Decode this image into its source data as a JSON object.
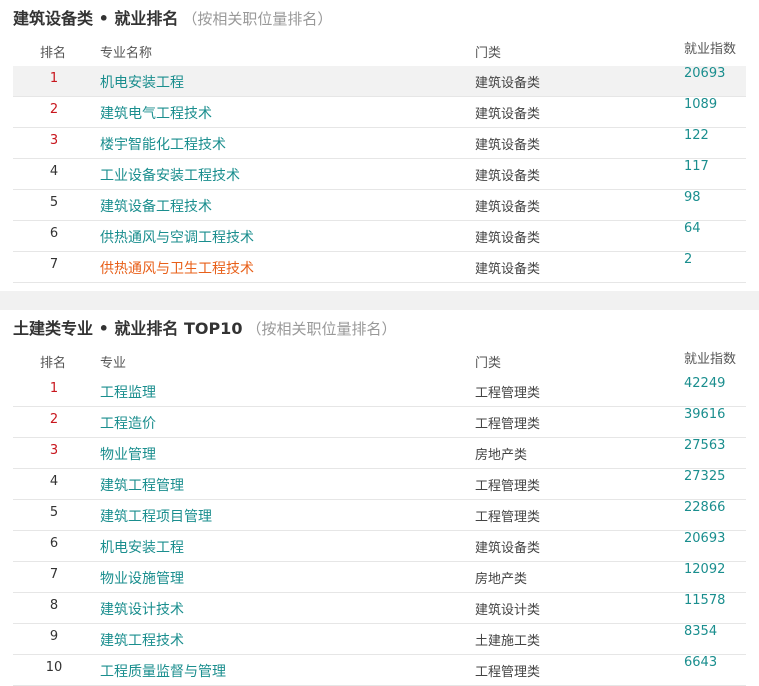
{
  "section1": {
    "title": "建筑设备类 • 就业排名",
    "note": "（按相关职位量排名）",
    "headers": {
      "rank": "排名",
      "major": "专业名称",
      "category": "门类",
      "index": "就业指数"
    },
    "rows": [
      {
        "rank": "1",
        "major": "机电安装工程",
        "category": "建筑设备类",
        "index": "20693"
      },
      {
        "rank": "2",
        "major": "建筑电气工程技术",
        "category": "建筑设备类",
        "index": "1089"
      },
      {
        "rank": "3",
        "major": "楼宇智能化工程技术",
        "category": "建筑设备类",
        "index": "122"
      },
      {
        "rank": "4",
        "major": "工业设备安装工程技术",
        "category": "建筑设备类",
        "index": "117"
      },
      {
        "rank": "5",
        "major": "建筑设备工程技术",
        "category": "建筑设备类",
        "index": "98"
      },
      {
        "rank": "6",
        "major": "供热通风与空调工程技术",
        "category": "建筑设备类",
        "index": "64"
      },
      {
        "rank": "7",
        "major": "供热通风与卫生工程技术",
        "category": "建筑设备类",
        "index": "2"
      }
    ]
  },
  "section2": {
    "title": "土建类专业 • 就业排名 TOP10",
    "note": "（按相关职位量排名）",
    "headers": {
      "rank": "排名",
      "major": "专业",
      "category": "门类",
      "index": "就业指数"
    },
    "rows": [
      {
        "rank": "1",
        "major": "工程监理",
        "category": "工程管理类",
        "index": "42249"
      },
      {
        "rank": "2",
        "major": "工程造价",
        "category": "工程管理类",
        "index": "39616"
      },
      {
        "rank": "3",
        "major": "物业管理",
        "category": "房地产类",
        "index": "27563"
      },
      {
        "rank": "4",
        "major": "建筑工程管理",
        "category": "工程管理类",
        "index": "27325"
      },
      {
        "rank": "5",
        "major": "建筑工程项目管理",
        "category": "工程管理类",
        "index": "22866"
      },
      {
        "rank": "6",
        "major": "机电安装工程",
        "category": "建筑设备类",
        "index": "20693"
      },
      {
        "rank": "7",
        "major": "物业设施管理",
        "category": "房地产类",
        "index": "12092"
      },
      {
        "rank": "8",
        "major": "建筑设计技术",
        "category": "建筑设计类",
        "index": "11578"
      },
      {
        "rank": "9",
        "major": "建筑工程技术",
        "category": "土建施工类",
        "index": "8354"
      },
      {
        "rank": "10",
        "major": "工程质量监督与管理",
        "category": "工程管理类",
        "index": "6643"
      }
    ]
  },
  "colors": {
    "link": "#1a8e8e",
    "rank_top": "#c8161d",
    "orange": "#e8601a",
    "row_highlight": "#f2f2f2"
  }
}
